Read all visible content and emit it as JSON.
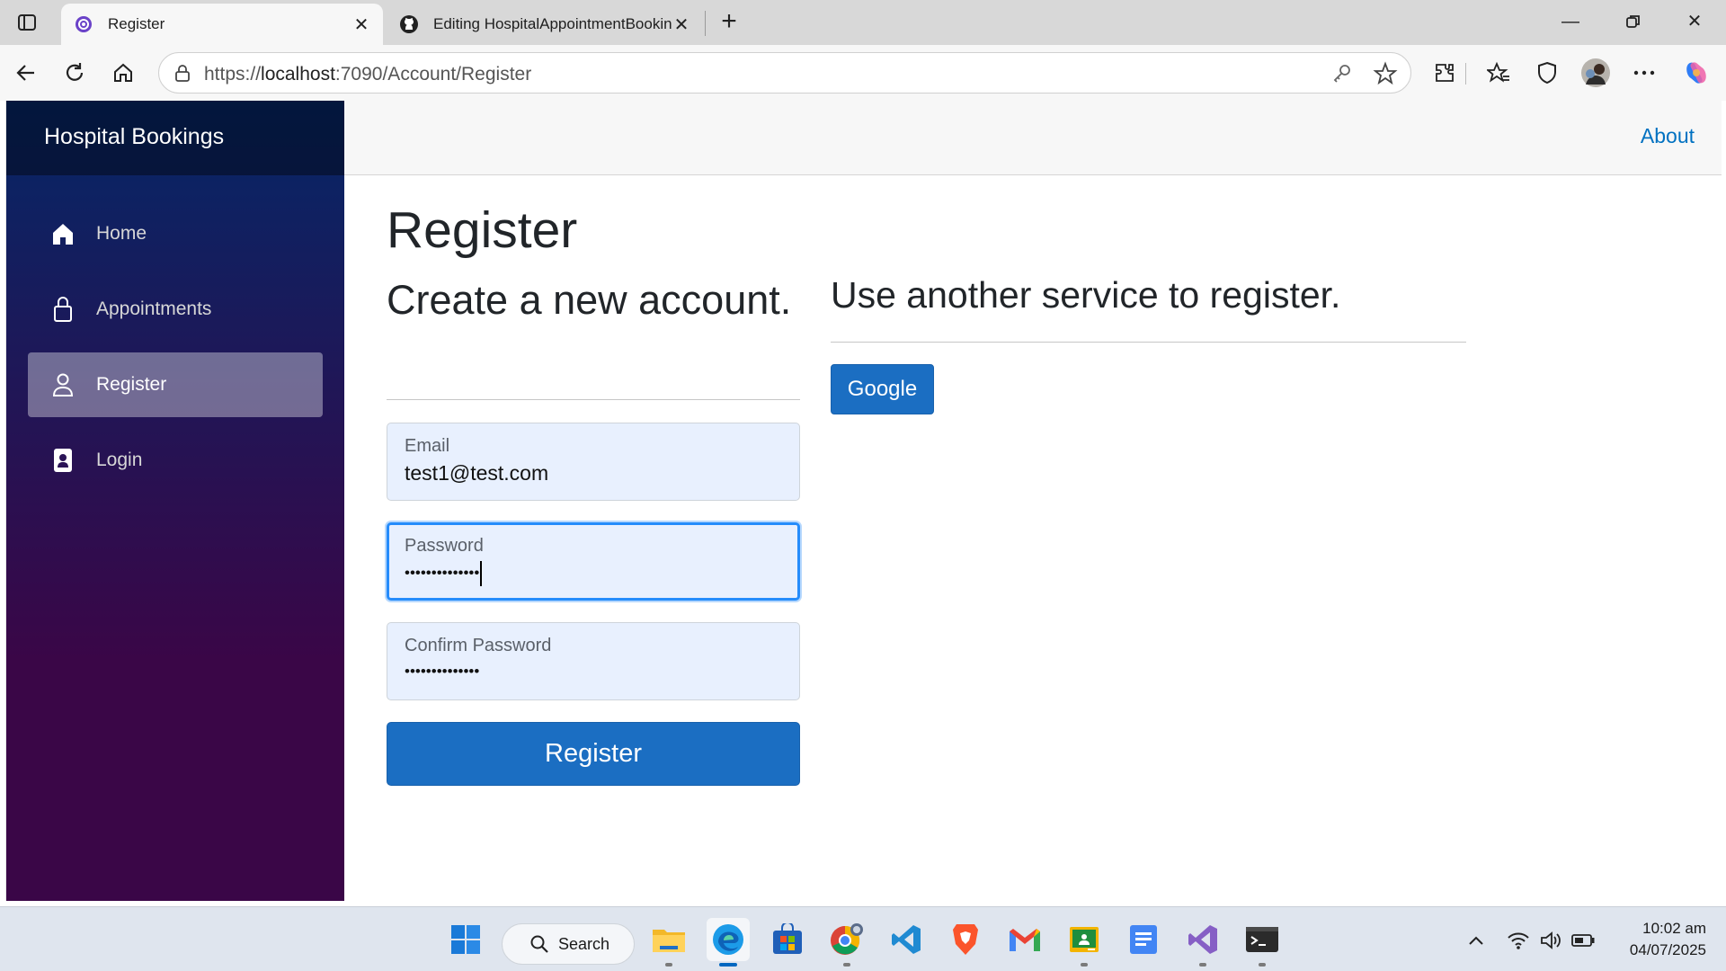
{
  "browser": {
    "tabs": [
      {
        "title": "Register",
        "active": true
      },
      {
        "title": "Editing HospitalAppointmentBooking",
        "active": false
      }
    ],
    "address": {
      "prefix": "https://",
      "host": "localhost",
      "rest": ":7090/Account/Register"
    }
  },
  "app": {
    "brand": "Hospital Bookings",
    "top_link": "About",
    "nav": [
      {
        "label": "Home",
        "icon": "home-icon",
        "active": false
      },
      {
        "label": "Appointments",
        "icon": "lock-icon",
        "active": false
      },
      {
        "label": "Register",
        "icon": "person-icon",
        "active": true
      },
      {
        "label": "Login",
        "icon": "person-badge-icon",
        "active": false
      }
    ],
    "accent": "#1b6ec2"
  },
  "page": {
    "title": "Register",
    "left_heading": "Create a new account.",
    "right_heading": "Use another service to register.",
    "external_button": "Google",
    "email": {
      "label": "Email",
      "value": "test1@test.com"
    },
    "password": {
      "label": "Password",
      "value": "••••••••••••••"
    },
    "confirm": {
      "label": "Confirm Password",
      "value": "••••••••••••••"
    },
    "submit": "Register"
  },
  "taskbar": {
    "search": "Search",
    "time": "10:02 am",
    "date": "04/07/2025"
  }
}
